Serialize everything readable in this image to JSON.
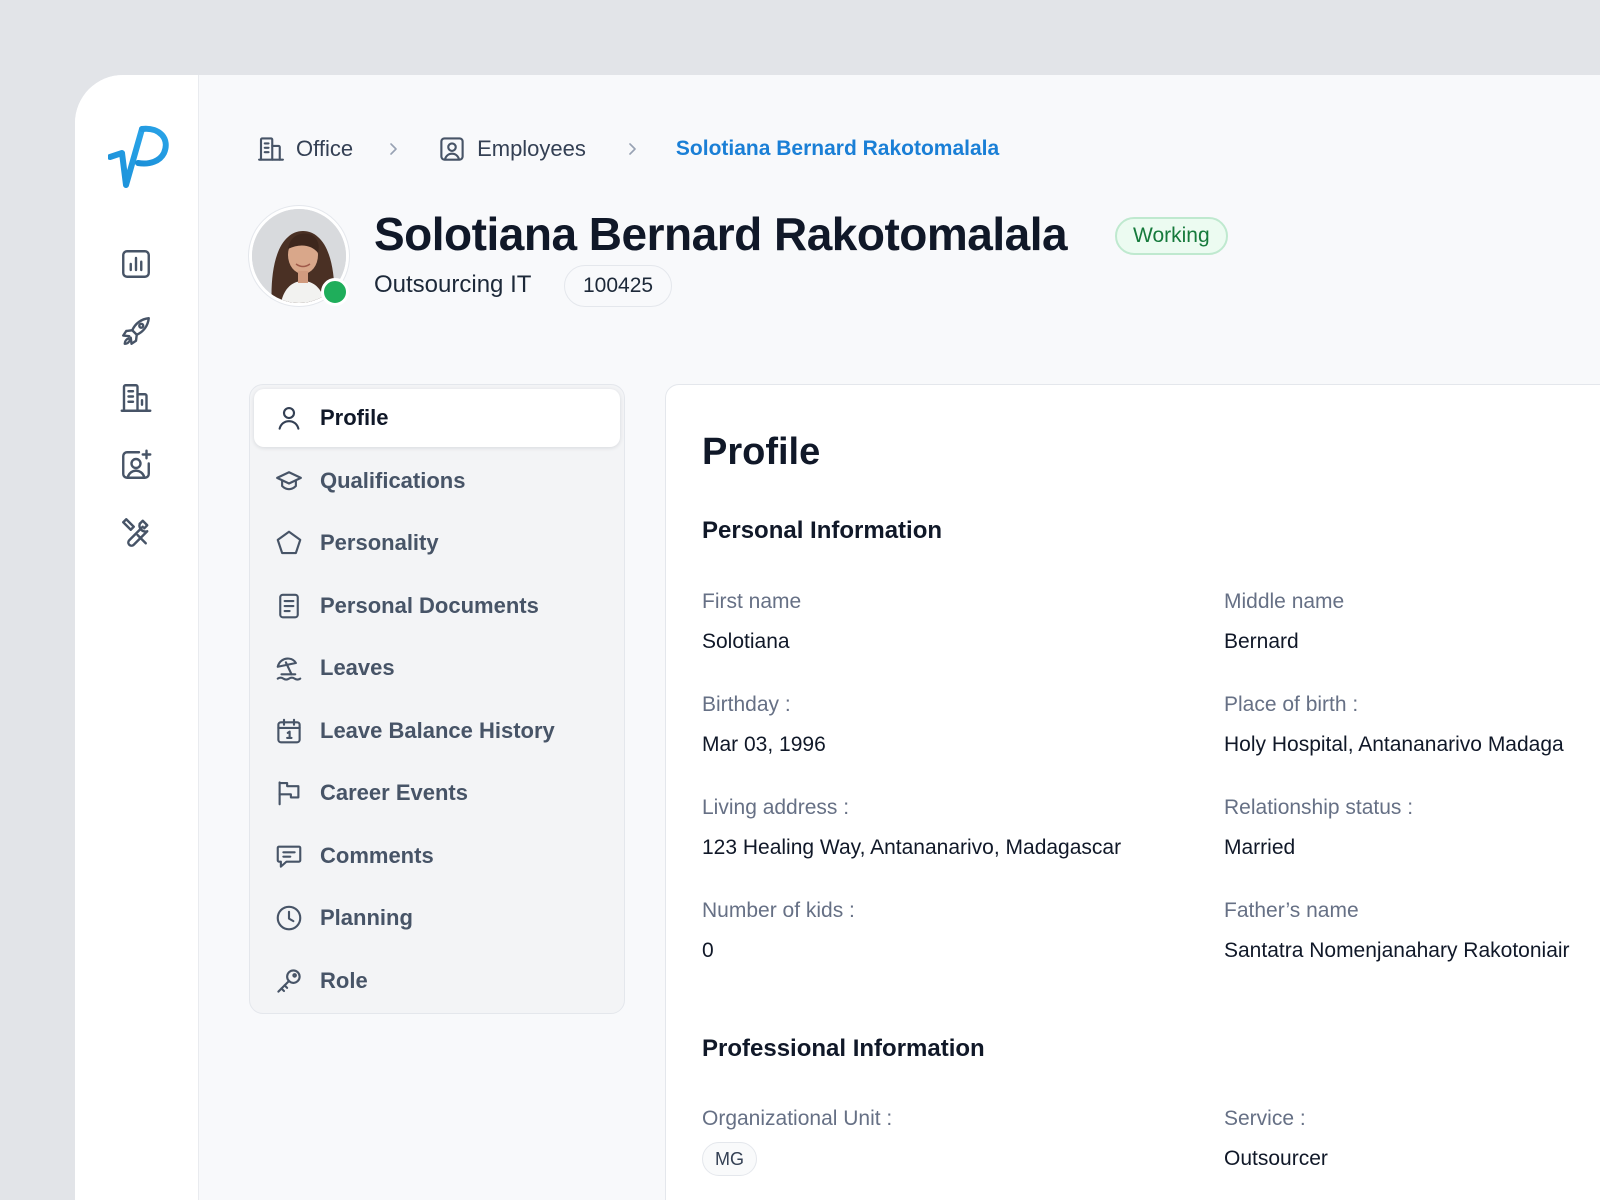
{
  "breadcrumb": {
    "office": "Office",
    "employees": "Employees",
    "current": "Solotiana Bernard Rakotomalala"
  },
  "employee": {
    "name": "Solotiana Bernard Rakotomalala",
    "status": "Working",
    "department": "Outsourcing IT",
    "id": "100425"
  },
  "rail": {
    "icons": [
      "logo-icon",
      "chart-icon",
      "rocket-icon",
      "building-icon",
      "user-add-icon",
      "tools-icon"
    ]
  },
  "menu": {
    "items": [
      {
        "label": "Profile",
        "icon": "user-icon",
        "active": true
      },
      {
        "label": "Qualifications",
        "icon": "graduation-cap-icon"
      },
      {
        "label": "Personality",
        "icon": "pentagon-icon"
      },
      {
        "label": "Personal Documents",
        "icon": "document-icon"
      },
      {
        "label": "Leaves",
        "icon": "beach-umbrella-icon"
      },
      {
        "label": "Leave Balance History",
        "icon": "calendar-icon"
      },
      {
        "label": "Career Events",
        "icon": "flag-icon"
      },
      {
        "label": "Comments",
        "icon": "message-icon"
      },
      {
        "label": "Planning",
        "icon": "clock-icon"
      },
      {
        "label": "Role",
        "icon": "key-icon"
      }
    ]
  },
  "profile": {
    "title": "Profile",
    "personal_title": "Personal Information",
    "fields": {
      "first_name": {
        "label": "First name",
        "value": "Solotiana"
      },
      "middle_name": {
        "label": "Middle name",
        "value": "Bernard"
      },
      "birthday": {
        "label": "Birthday :",
        "value": "Mar 03, 1996"
      },
      "place_of_birth": {
        "label": "Place of birth :",
        "value": "Holy Hospital, Antananarivo Madaga"
      },
      "living_address": {
        "label": "Living address :",
        "value": "123 Healing Way, Antananarivo, Madagascar"
      },
      "relationship": {
        "label": "Relationship status :",
        "value": "Married"
      },
      "kids": {
        "label": "Number of kids :",
        "value": "0"
      },
      "father": {
        "label": "Father’s name",
        "value": "Santatra Nomenjanahary Rakotoniair"
      }
    },
    "professional_title": "Professional Information",
    "professional": {
      "org_unit": {
        "label": "Organizational Unit :",
        "value": "MG"
      },
      "service": {
        "label": "Service :",
        "value": "Outsourcer"
      }
    }
  },
  "colors": {
    "accent": "#1a7fd6",
    "status_green": "#1fae5b",
    "badge_bg": "#ecfbf1",
    "badge_text": "#167a3c"
  }
}
